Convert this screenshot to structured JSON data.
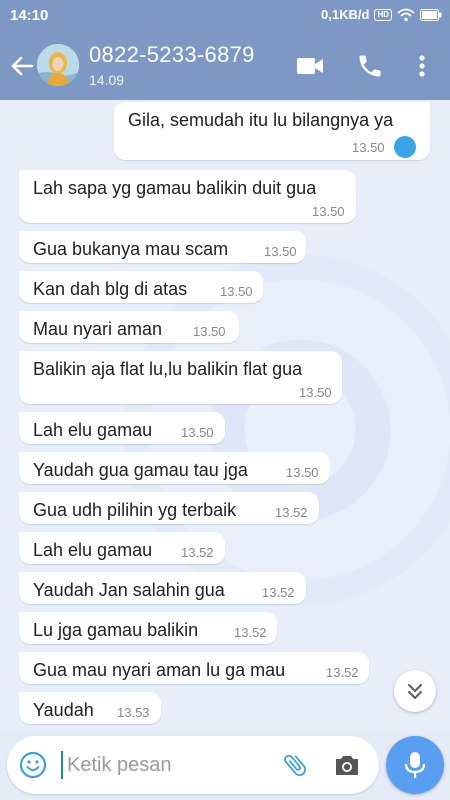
{
  "status_bar": {
    "time": "14:10",
    "network_speed": "0,1KB/d",
    "indicator_label": "HD",
    "icons": [
      "wifi-icon",
      "battery-icon"
    ]
  },
  "header": {
    "contact_name": "0822-5233-6879",
    "contact_subtitle": "14.09",
    "icons": [
      "back-arrow-icon",
      "video-call-icon",
      "phone-icon",
      "more-vert-icon"
    ]
  },
  "messages": [
    {
      "direction": "out",
      "text": "Gila, semudah itu lu bilangnya ya",
      "time": "13.50",
      "status": "seen"
    },
    {
      "direction": "in",
      "text": "Lah sapa yg gamau balikin duit gua",
      "time": "13.50"
    },
    {
      "direction": "in",
      "text": "Gua bukanya mau scam",
      "time": "13.50"
    },
    {
      "direction": "in",
      "text": "Kan dah blg di atas",
      "time": "13.50"
    },
    {
      "direction": "in",
      "text": "Mau nyari aman",
      "time": "13.50"
    },
    {
      "direction": "in",
      "text": "Balikin aja flat lu,lu balikin flat gua",
      "time": "13.50"
    },
    {
      "direction": "in",
      "text": "Lah elu gamau",
      "time": "13.50"
    },
    {
      "direction": "in",
      "text": "Yaudah gua gamau tau jga",
      "time": "13.50"
    },
    {
      "direction": "in",
      "text": "Gua udh pilihin yg terbaik",
      "time": "13.52"
    },
    {
      "direction": "in",
      "text": "Lah elu gamau",
      "time": "13.52"
    },
    {
      "direction": "in",
      "text": "Yaudah Jan salahin gua",
      "time": "13.52"
    },
    {
      "direction": "in",
      "text": "Lu jga gamau balikin",
      "time": "13.52"
    },
    {
      "direction": "in",
      "text": "Gua mau nyari aman lu ga mau",
      "time": "13.52"
    },
    {
      "direction": "in",
      "text": "Yaudah",
      "time": "13.53"
    }
  ],
  "composer": {
    "placeholder": "Ketik pesan",
    "value": ""
  },
  "colors": {
    "header_bg": "#7d98c4",
    "chat_bg": "#e6ebf8",
    "seen_indicator": "#3ba4e8",
    "mic_button": "#5a9ef2",
    "caret": "#1e8f7e"
  }
}
